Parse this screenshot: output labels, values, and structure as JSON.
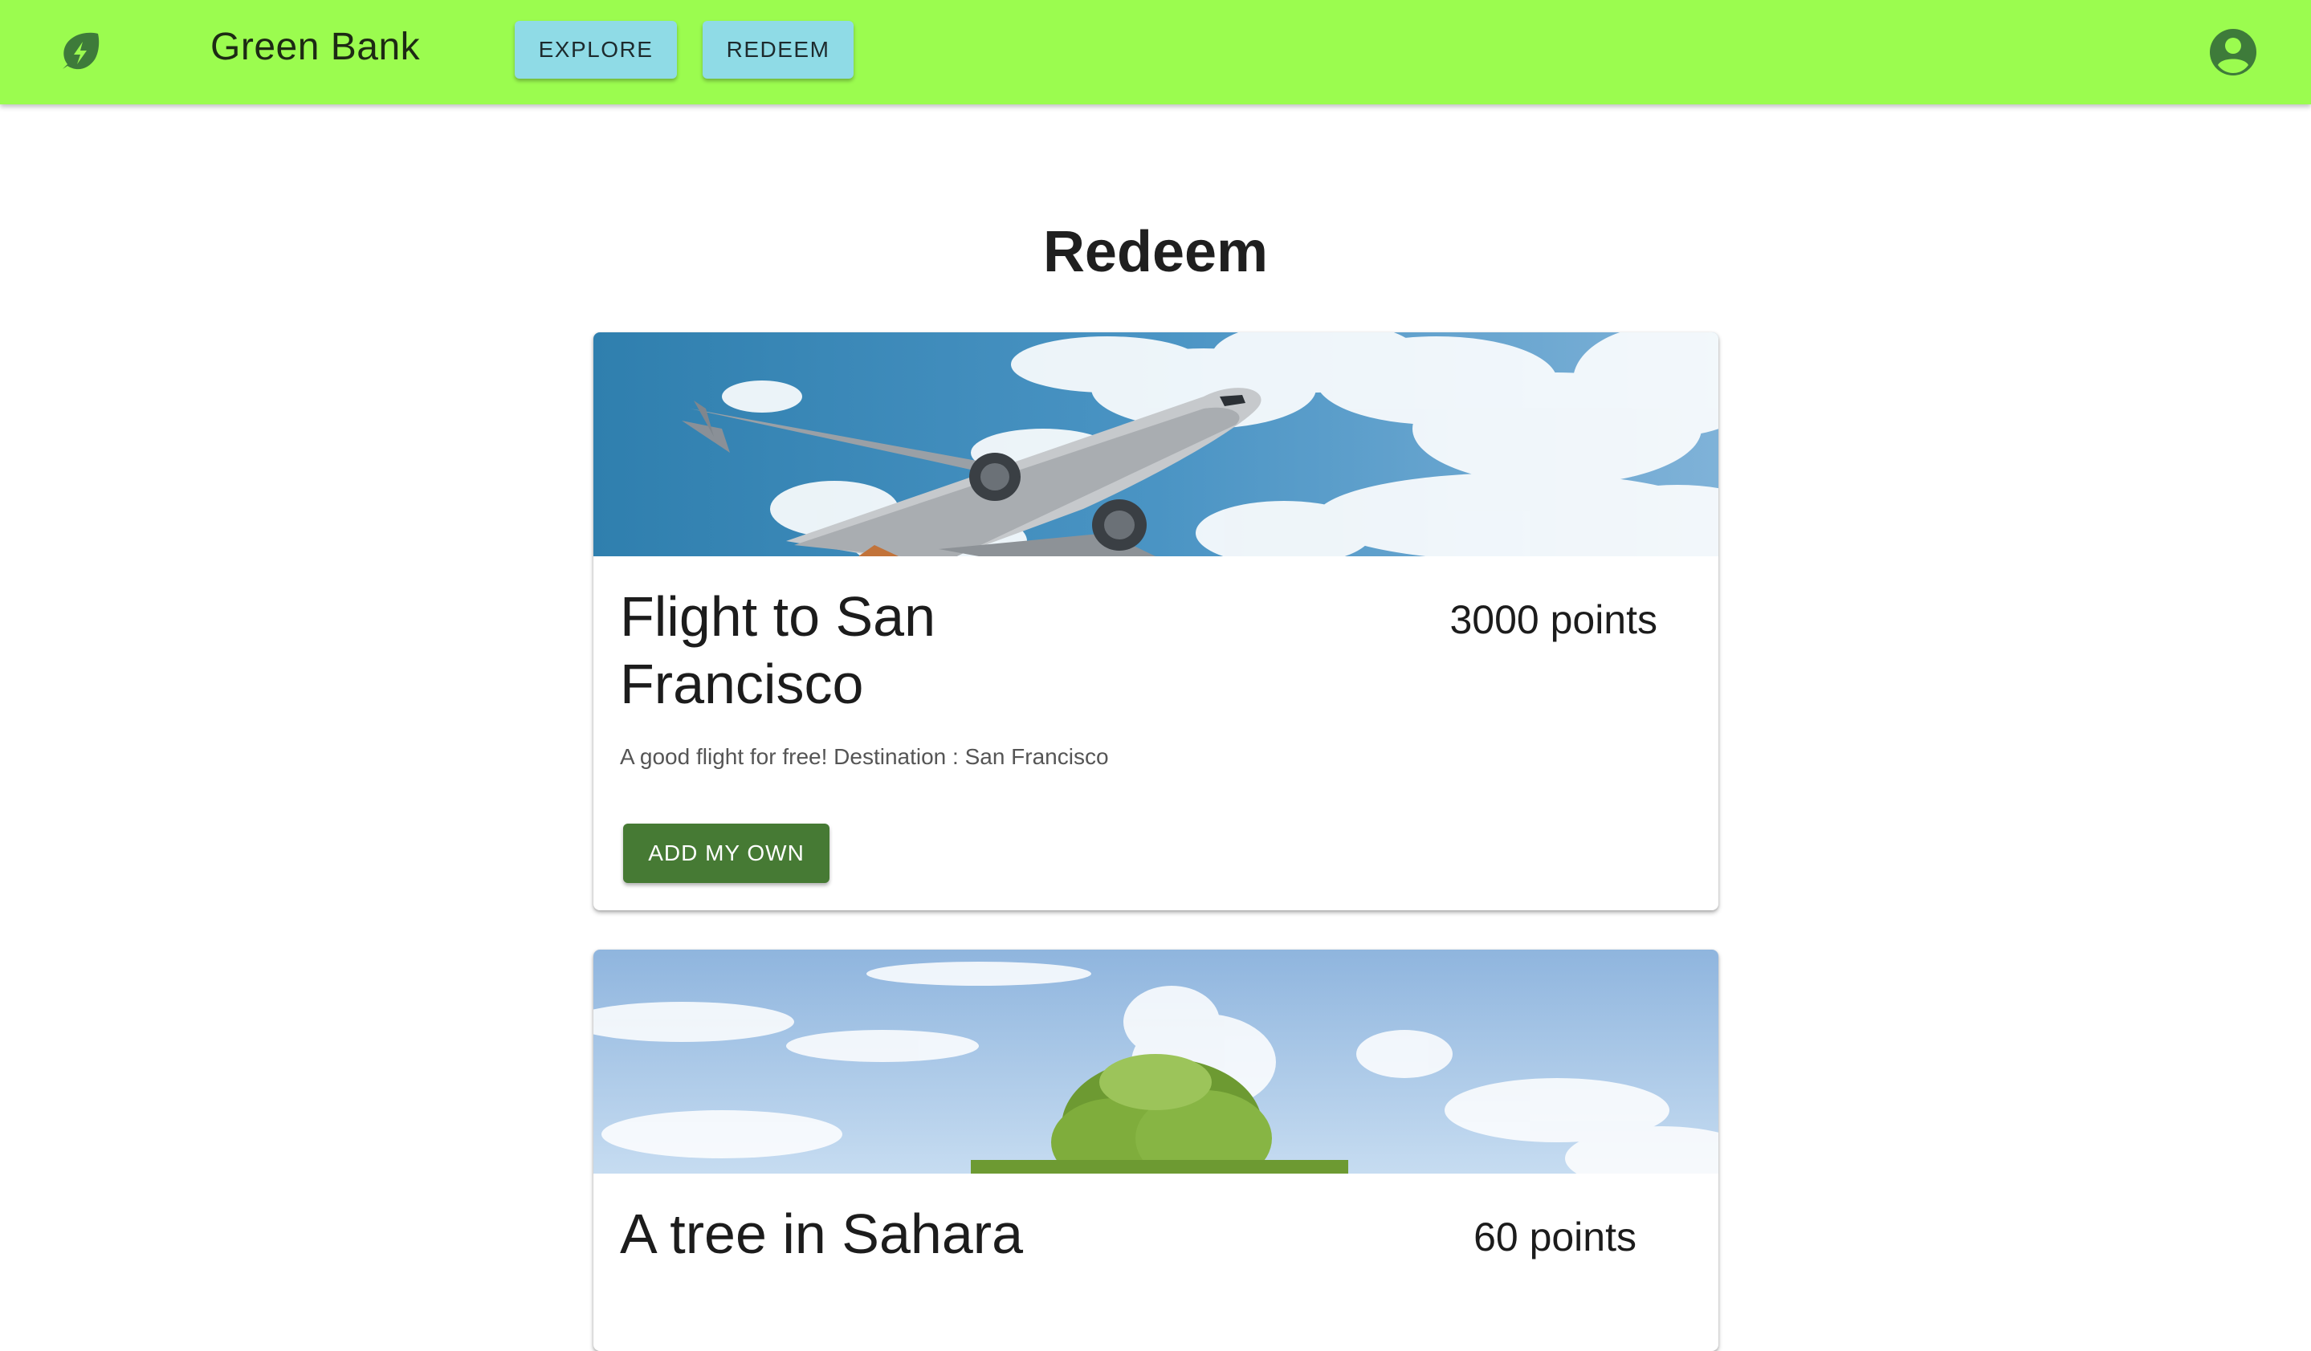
{
  "header": {
    "brand": "Green Bank",
    "nav": {
      "explore_label": "EXPLORE",
      "redeem_label": "REDEEM"
    },
    "colors": {
      "bar": "#9bfc4f",
      "nav_button": "#8fdbe6",
      "logo": "#3e7b3a"
    },
    "icons": {
      "logo": "leaf-bolt-icon",
      "account": "account-circle-icon"
    }
  },
  "page": {
    "title": "Redeem"
  },
  "rewards": [
    {
      "title": "Flight to San Francisco",
      "points": "3000 points",
      "description": "A good flight for free! Destination : San Francisco",
      "button_label": "ADD MY OWN",
      "image": "airplane in cloudy sky"
    },
    {
      "title": "A tree in Sahara",
      "points": "60 points",
      "image": "tree under cloudy sky"
    }
  ],
  "colors": {
    "primary_button": "#467a34"
  }
}
